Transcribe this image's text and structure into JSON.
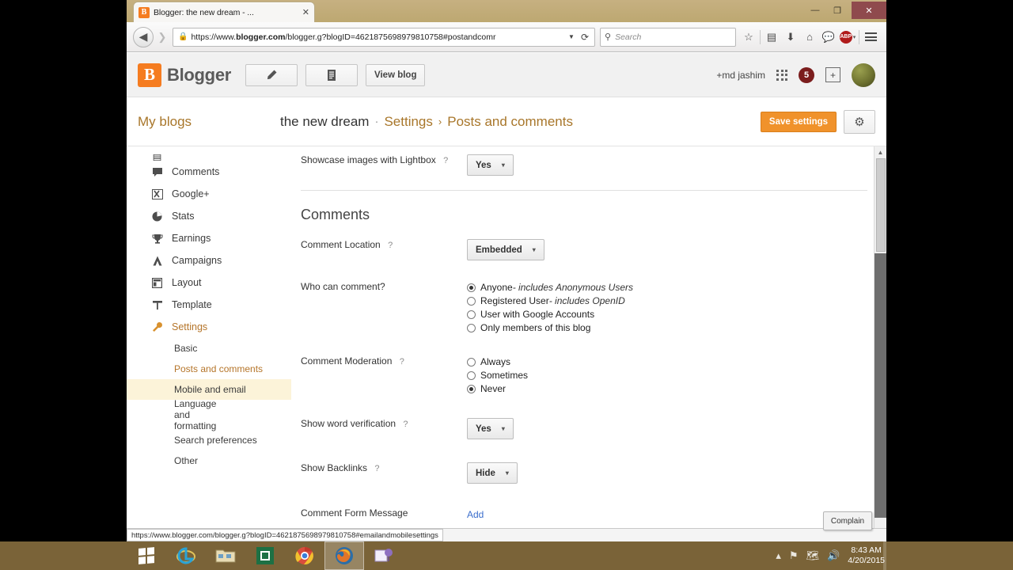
{
  "window": {
    "tab_title": "Blogger: the new dream - ...",
    "tab_close": "✕",
    "minimize": "—",
    "maximize": "❐",
    "close": "✕"
  },
  "browser": {
    "back_icon": "◀",
    "forward_icon": "❯",
    "lock_icon": "🔒",
    "url_prefix": "https://www.",
    "url_domain": "blogger.com",
    "url_suffix": "/blogger.g?blogID=4621875698979810758#postandcomr",
    "url_dropdown": "▼",
    "reload_icon": "⟳",
    "search_placeholder": "Search",
    "search_icon": "⚲",
    "bookmark_icon": "☆",
    "reader_icon": "▤",
    "download_icon": "⬇",
    "home_icon": "⌂",
    "chat_icon": "💬",
    "adblock_label": "ABP",
    "adblock_caret": "▾",
    "menu_icon": "☰"
  },
  "blogger_header": {
    "logo_glyph": "B",
    "wordmark": "Blogger",
    "new_post_icon": "pencil-icon",
    "posts_icon": "document-icon",
    "view_blog_label": "View blog",
    "user_label": "+md jashim",
    "apps_icon": "apps-grid-icon",
    "notification_count": "5",
    "share_icon": "+",
    "avatar": "avatar-image"
  },
  "title_bar": {
    "my_blogs": "My blogs",
    "blog_name": "the new dream",
    "separator_dot": "·",
    "settings_label": "Settings",
    "chevron": "›",
    "current_page": "Posts and comments",
    "save_label": "Save settings",
    "gear_icon": "⚙"
  },
  "sidebar": {
    "items": [
      {
        "label": "Comments",
        "icon": "comment-bubble-icon",
        "glyph": "💬",
        "active": false
      },
      {
        "label": "Google+",
        "icon": "google-plus-icon",
        "glyph": "g+",
        "active": false
      },
      {
        "label": "Stats",
        "icon": "pie-chart-icon",
        "glyph": "◕",
        "active": false
      },
      {
        "label": "Earnings",
        "icon": "trophy-icon",
        "glyph": "🏆",
        "active": false
      },
      {
        "label": "Campaigns",
        "icon": "megaphone-icon",
        "glyph": "A",
        "active": false
      },
      {
        "label": "Layout",
        "icon": "layout-icon",
        "glyph": "▤",
        "active": false
      },
      {
        "label": "Template",
        "icon": "paint-roller-icon",
        "glyph": "⊤",
        "active": false
      },
      {
        "label": "Settings",
        "icon": "wrench-icon",
        "glyph": "🔧",
        "active": true
      }
    ],
    "sub_items": [
      {
        "label": "Basic",
        "state": "normal"
      },
      {
        "label": "Posts and comments",
        "state": "current"
      },
      {
        "label": "Mobile and email",
        "state": "hover"
      },
      {
        "label": "Language and formatting",
        "state": "normal"
      },
      {
        "label": "Search preferences",
        "state": "normal"
      },
      {
        "label": "Other",
        "state": "normal"
      }
    ]
  },
  "main": {
    "lightbox_row": {
      "label": "Showcase images with Lightbox",
      "help": "?",
      "value": "Yes",
      "arrow": "▾"
    },
    "comments_section_title": "Comments",
    "comment_location": {
      "label": "Comment Location",
      "help": "?",
      "value": "Embedded",
      "arrow": "▾"
    },
    "who_can_comment": {
      "label": "Who can comment?",
      "options": [
        {
          "text": "Anyone",
          "note": " - includes Anonymous Users",
          "selected": true
        },
        {
          "text": "Registered User",
          "note": " - includes OpenID",
          "selected": false
        },
        {
          "text": "User with Google Accounts",
          "note": "",
          "selected": false
        },
        {
          "text": "Only members of this blog",
          "note": "",
          "selected": false
        }
      ]
    },
    "comment_moderation": {
      "label": "Comment Moderation",
      "help": "?",
      "options": [
        {
          "text": "Always",
          "selected": false
        },
        {
          "text": "Sometimes",
          "selected": false
        },
        {
          "text": "Never",
          "selected": true
        }
      ]
    },
    "word_verification": {
      "label": "Show word verification",
      "help": "?",
      "value": "Yes",
      "arrow": "▾"
    },
    "backlinks": {
      "label": "Show Backlinks",
      "help": "?",
      "value": "Hide",
      "arrow": "▾"
    },
    "comment_form_message": {
      "label": "Comment Form Message",
      "link": "Add"
    }
  },
  "status": {
    "hover_url": "https://www.blogger.com/blogger.g?blogID=4621875698979810758#emailandmobilesettings",
    "complain_label": "Complain"
  },
  "scroll": {
    "up_arrow": "▲",
    "down_arrow": "▼"
  },
  "taskbar": {
    "items": [
      {
        "name": "start-button",
        "glyph": ""
      },
      {
        "name": "internet-explorer",
        "glyph": "e"
      },
      {
        "name": "file-explorer",
        "glyph": "🗂"
      },
      {
        "name": "excel-app",
        "glyph": "X"
      },
      {
        "name": "chrome-browser",
        "glyph": "◉"
      },
      {
        "name": "firefox-browser",
        "glyph": "🦊"
      },
      {
        "name": "media-app",
        "glyph": "🎈"
      }
    ],
    "tray": {
      "chevron": "▴",
      "flag_icon": "⚑",
      "network_icon": "🖧",
      "volume_icon": "🔊",
      "time": "8:43 AM",
      "date": "4/20/2015"
    }
  }
}
